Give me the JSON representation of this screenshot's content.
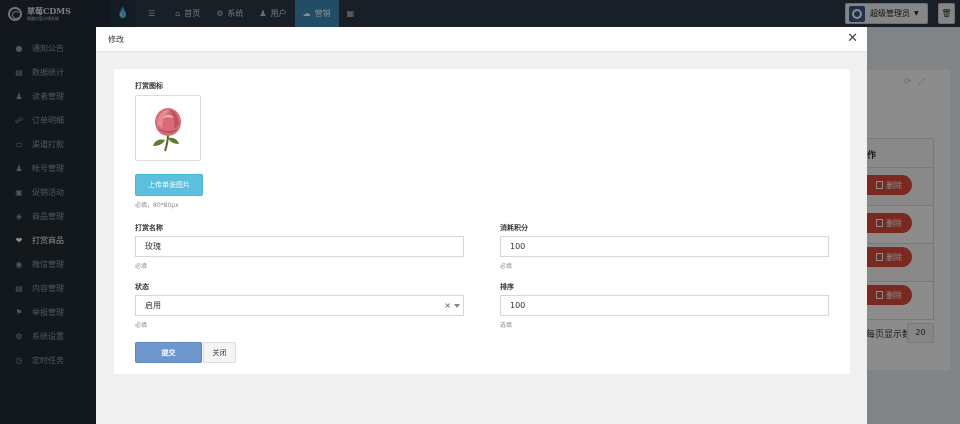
{
  "topbar": {
    "logo_title": "草莓CDMS",
    "logo_subtitle": "挪趣内容分销系统",
    "nav": [
      {
        "label": "首页",
        "icon": "home-icon"
      },
      {
        "label": "系统",
        "icon": "gear-icon"
      },
      {
        "label": "用户",
        "icon": "user-icon"
      },
      {
        "label": "营销",
        "icon": "cloud-icon"
      }
    ],
    "admin_label": "超级管理员"
  },
  "sidebar": {
    "items": [
      {
        "label": "通知公告",
        "icon": "comment-icon"
      },
      {
        "label": "数据统计",
        "icon": "chart-icon"
      },
      {
        "label": "读者管理",
        "icon": "user-icon"
      },
      {
        "label": "订单明细",
        "icon": "cart-icon"
      },
      {
        "label": "渠道打款",
        "icon": "card-icon"
      },
      {
        "label": "帐号管理",
        "icon": "user-icon"
      },
      {
        "label": "促销活动",
        "icon": "gift-icon"
      },
      {
        "label": "商品管理",
        "icon": "tag-icon"
      },
      {
        "label": "打赏商品",
        "icon": "heart-icon"
      },
      {
        "label": "微信管理",
        "icon": "wechat-icon"
      },
      {
        "label": "内容管理",
        "icon": "book-icon"
      },
      {
        "label": "举报管理",
        "icon": "flag-icon"
      },
      {
        "label": "系统设置",
        "icon": "gear-icon"
      },
      {
        "label": "定时任务",
        "icon": "clock-icon"
      }
    ]
  },
  "background_table": {
    "header_fragment": "作",
    "delete_label": "删除",
    "per_page_label": "每页显示数量",
    "per_page_value": "20"
  },
  "modal": {
    "title": "修改",
    "icon_label": "打赏图标",
    "upload_label": "上传单张图片",
    "upload_help": "必填，80*80px",
    "name_label": "打赏名称",
    "name_value": "玫瑰",
    "name_help": "必填",
    "points_label": "消耗积分",
    "points_value": "100",
    "points_help": "必填",
    "status_label": "状态",
    "status_value": "启用",
    "status_help": "必填",
    "sort_label": "排序",
    "sort_value": "100",
    "sort_help": "选填",
    "submit_label": "提交",
    "close_label": "关闭"
  }
}
